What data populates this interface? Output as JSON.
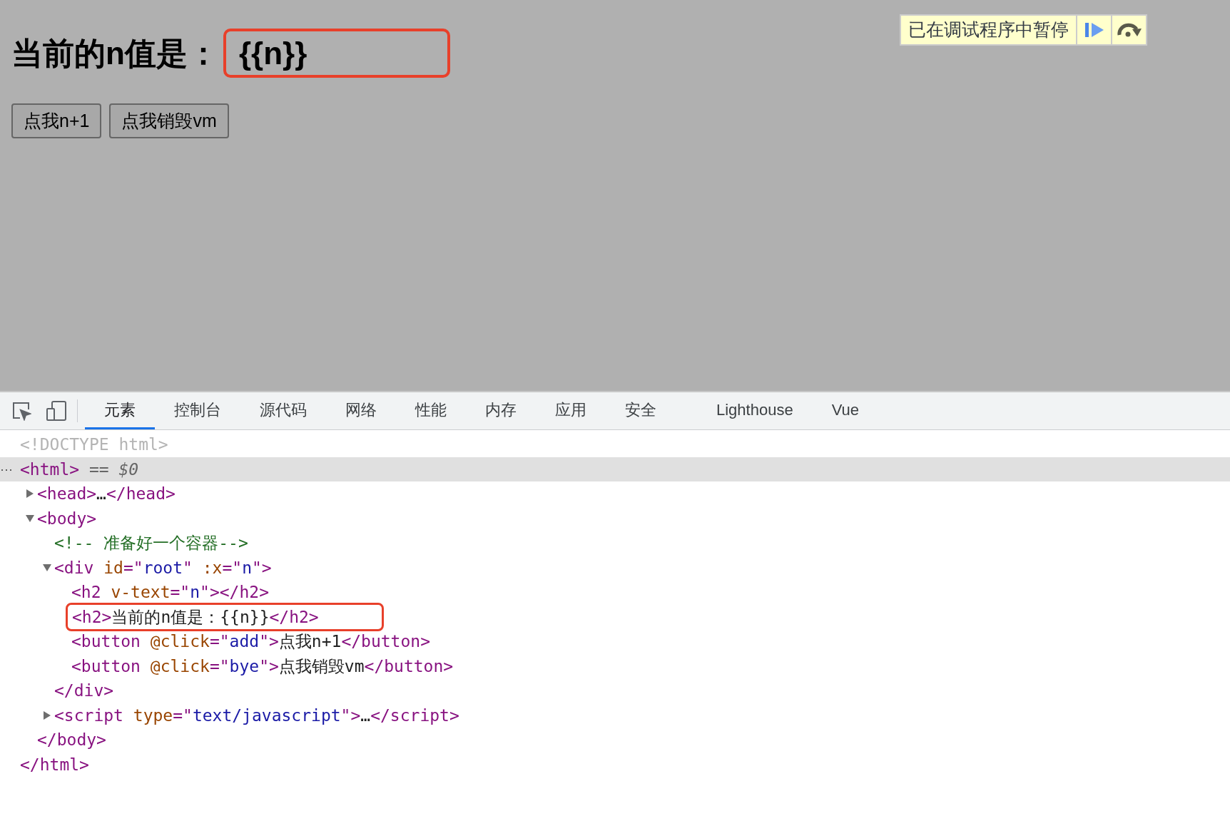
{
  "page": {
    "heading": {
      "label": "当前的n值是：",
      "value": "{{n}}",
      "value_annotated": true
    },
    "buttons": [
      "点我n+1",
      "点我销毁vm"
    ],
    "debugger_banner": {
      "text": "已在调试程序中暂停"
    }
  },
  "devtools": {
    "tabs": [
      {
        "label": "元素",
        "selected": true
      },
      {
        "label": "控制台",
        "selected": false
      },
      {
        "label": "源代码",
        "selected": false
      },
      {
        "label": "网络",
        "selected": false
      },
      {
        "label": "性能",
        "selected": false
      },
      {
        "label": "内存",
        "selected": false
      },
      {
        "label": "应用",
        "selected": false
      },
      {
        "label": "安全",
        "selected": false
      },
      {
        "label": "Lighthouse",
        "selected": false
      },
      {
        "label": "Vue",
        "selected": false
      }
    ],
    "nodes": [
      {
        "selected": false,
        "annotated": false,
        "tokens": [
          {
            "kind": "doctype",
            "text": "<!DOCTYPE html>"
          }
        ]
      },
      {
        "selected": true,
        "annotated": false,
        "menu": "⋯",
        "tokens": [
          {
            "kind": "tag",
            "text": "<html>"
          },
          {
            "kind": "marker",
            "text": " == "
          },
          {
            "kind": "var",
            "text": "$0"
          }
        ],
        "children": [
          {
            "selected": false,
            "annotated": false,
            "expanded": false,
            "tokens": [
              {
                "kind": "tag",
                "text": "<head>"
              },
              {
                "kind": "text",
                "text": "…"
              },
              {
                "kind": "tag",
                "text": "</head>"
              }
            ]
          },
          {
            "selected": false,
            "annotated": false,
            "expanded": true,
            "tokens": [
              {
                "kind": "tag",
                "text": "<body>"
              }
            ],
            "children": [
              {
                "selected": false,
                "annotated": false,
                "tokens": [
                  {
                    "kind": "comment",
                    "text": "<!-- 准备好一个容器-->"
                  }
                ]
              },
              {
                "selected": false,
                "annotated": false,
                "expanded": true,
                "tokens": [
                  {
                    "kind": "tag",
                    "text": "<div "
                  },
                  {
                    "kind": "attr",
                    "text": "id"
                  },
                  {
                    "kind": "tag",
                    "text": "=\""
                  },
                  {
                    "kind": "value",
                    "text": "root"
                  },
                  {
                    "kind": "tag",
                    "text": "\" "
                  },
                  {
                    "kind": "attr",
                    "text": ":x"
                  },
                  {
                    "kind": "tag",
                    "text": "=\""
                  },
                  {
                    "kind": "value",
                    "text": "n"
                  },
                  {
                    "kind": "tag",
                    "text": "\">"
                  }
                ],
                "children": [
                  {
                    "selected": false,
                    "annotated": false,
                    "tokens": [
                      {
                        "kind": "tag",
                        "text": "<h2 "
                      },
                      {
                        "kind": "attr",
                        "text": "v-text"
                      },
                      {
                        "kind": "tag",
                        "text": "=\""
                      },
                      {
                        "kind": "value",
                        "text": "n"
                      },
                      {
                        "kind": "tag",
                        "text": "\"></h2>"
                      }
                    ]
                  },
                  {
                    "selected": false,
                    "annotated": true,
                    "tokens": [
                      {
                        "kind": "tag",
                        "text": "<h2>"
                      },
                      {
                        "kind": "text",
                        "text": "当前的n值是：{{n}}"
                      },
                      {
                        "kind": "tag",
                        "text": "</h2>"
                      }
                    ]
                  },
                  {
                    "selected": false,
                    "annotated": false,
                    "tokens": [
                      {
                        "kind": "tag",
                        "text": "<button "
                      },
                      {
                        "kind": "attr",
                        "text": "@click"
                      },
                      {
                        "kind": "tag",
                        "text": "=\""
                      },
                      {
                        "kind": "value",
                        "text": "add"
                      },
                      {
                        "kind": "tag",
                        "text": "\">"
                      },
                      {
                        "kind": "text",
                        "text": "点我n+1"
                      },
                      {
                        "kind": "tag",
                        "text": "</button>"
                      }
                    ]
                  },
                  {
                    "selected": false,
                    "annotated": false,
                    "tokens": [
                      {
                        "kind": "tag",
                        "text": "<button "
                      },
                      {
                        "kind": "attr",
                        "text": "@click"
                      },
                      {
                        "kind": "tag",
                        "text": "=\""
                      },
                      {
                        "kind": "value",
                        "text": "bye"
                      },
                      {
                        "kind": "tag",
                        "text": "\">"
                      },
                      {
                        "kind": "text",
                        "text": "点我销毁vm"
                      },
                      {
                        "kind": "tag",
                        "text": "</button>"
                      }
                    ]
                  }
                ],
                "closing": [
                  {
                    "kind": "tag",
                    "text": "</div>"
                  }
                ]
              },
              {
                "selected": false,
                "annotated": false,
                "expanded": false,
                "tokens": [
                  {
                    "kind": "tag",
                    "text": "<script "
                  },
                  {
                    "kind": "attr",
                    "text": "type"
                  },
                  {
                    "kind": "tag",
                    "text": "=\""
                  },
                  {
                    "kind": "value",
                    "text": "text/javascript"
                  },
                  {
                    "kind": "tag",
                    "text": "\">"
                  },
                  {
                    "kind": "text",
                    "text": "…"
                  },
                  {
                    "kind": "tag",
                    "text": "</script>"
                  }
                ]
              }
            ],
            "closing": [
              {
                "kind": "tag",
                "text": "</body>"
              }
            ]
          }
        ],
        "closing": [
          {
            "kind": "tag",
            "text": "</html>"
          }
        ]
      }
    ]
  }
}
